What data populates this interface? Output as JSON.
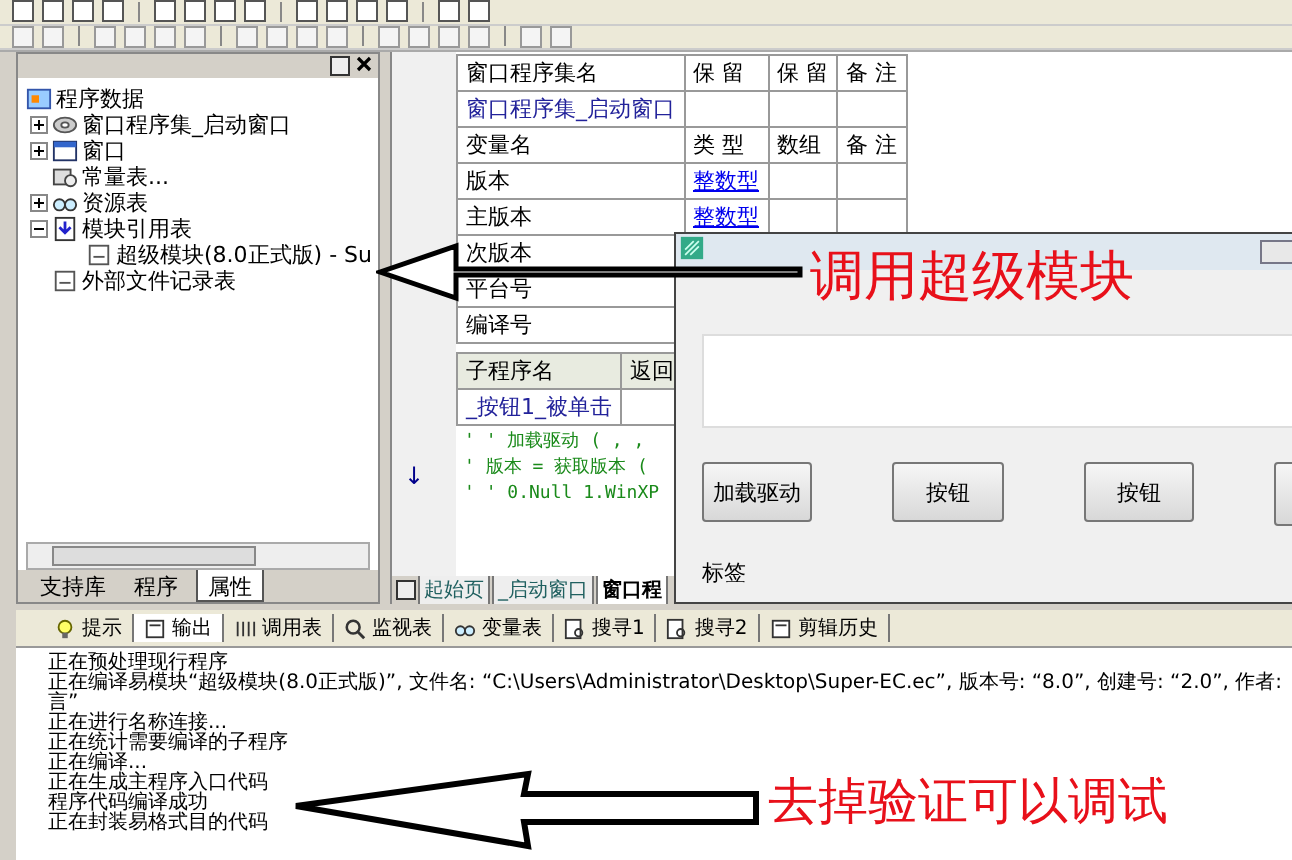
{
  "project_panel": {
    "root": "程序数据",
    "tree": [
      {
        "label": "窗口程序集_启动窗口",
        "expanded": false
      },
      {
        "label": "窗口",
        "expanded": false
      },
      {
        "label": "常量表..."
      },
      {
        "label": "资源表",
        "expanded": false
      },
      {
        "label": "模块引用表",
        "expanded": true,
        "children": [
          {
            "label": "超级模块(8.0正式版) - Su"
          }
        ]
      },
      {
        "label": "外部文件记录表"
      }
    ],
    "tabs": [
      {
        "label": "支持库",
        "selected": false
      },
      {
        "label": "程序",
        "selected": false
      },
      {
        "label": "属性",
        "selected": true
      }
    ]
  },
  "code_editor": {
    "assembly_table": {
      "columns": [
        "窗口程序集名",
        "保 留",
        "保 留",
        "备 注"
      ],
      "rows": [
        [
          "窗口程序集_启动窗口",
          "",
          "",
          ""
        ]
      ]
    },
    "variable_table": {
      "columns": [
        "变量名",
        "类 型",
        "数组",
        "备 注"
      ],
      "rows": [
        [
          "版本",
          "整数型",
          "",
          ""
        ],
        [
          "主版本",
          "整数型",
          "",
          ""
        ],
        [
          "次版本",
          "",
          "",
          ""
        ],
        [
          "平台号",
          "",
          "",
          ""
        ],
        [
          "编译号",
          "",
          "",
          ""
        ]
      ]
    },
    "subroutine_table": {
      "columns": [
        "子程序名",
        "返回"
      ],
      "rows": [
        [
          "_按钮1_被单击",
          ""
        ]
      ]
    },
    "code_lines": [
      {
        "text": "' ' 加载驱动 ( , ,"
      },
      {
        "text": "' 版本 = 获取版本 (",
        "gutter": "↓"
      },
      {
        "text": "' ' 0.Null 1.WinXP"
      }
    ],
    "tabs": [
      {
        "label": "起始页",
        "selected": false
      },
      {
        "label": "_启动窗口",
        "selected": false
      },
      {
        "label": "窗口程",
        "selected": true
      }
    ]
  },
  "output_panel": {
    "tabs": [
      {
        "label": "提示",
        "selected": false
      },
      {
        "label": "输出",
        "selected": true
      },
      {
        "label": "调用表",
        "selected": false
      },
      {
        "label": "监视表",
        "selected": false
      },
      {
        "label": "变量表",
        "selected": false
      },
      {
        "label": "搜寻1",
        "selected": false
      },
      {
        "label": "搜寻2",
        "selected": false
      },
      {
        "label": "剪辑历史",
        "selected": false
      }
    ],
    "lines": [
      "正在预处理现行程序",
      "正在编译易模块“超级模块(8.0正式版)”, 文件名: “C:\\Users\\Administrator\\Desktop\\Super-EC.ec”, 版本号: “8.0”, 创建号: “2.0”, 作者:",
      "言”",
      "正在进行名称连接...",
      "正在统计需要编译的子程序",
      "正在编译...",
      "正在生成主程序入口代码",
      "程序代码编译成功",
      "正在封装易格式目的代码"
    ]
  },
  "dialog": {
    "buttons": [
      "加载驱动",
      "按钮",
      "按钮"
    ],
    "label": "标签"
  },
  "annotations": [
    "调用超级模块",
    "去掉验证可以调试"
  ]
}
